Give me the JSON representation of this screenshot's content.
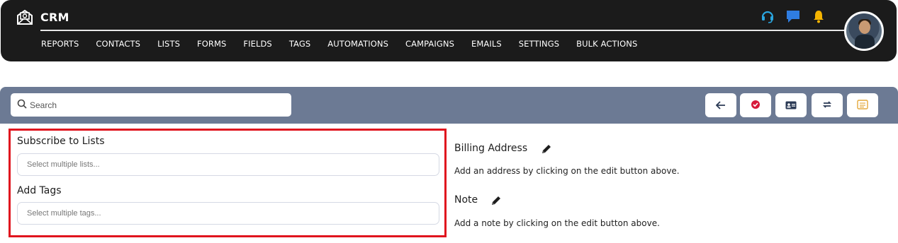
{
  "app": {
    "brand": "CRM"
  },
  "nav": [
    "REPORTS",
    "CONTACTS",
    "LISTS",
    "FORMS",
    "FIELDS",
    "TAGS",
    "AUTOMATIONS",
    "CAMPAIGNS",
    "EMAILS",
    "SETTINGS",
    "BULK ACTIONS"
  ],
  "search": {
    "placeholder": "Search"
  },
  "toolbar": {
    "buttons": [
      "back-arrow-icon",
      "check-circle-icon",
      "id-card-icon",
      "sync-icon",
      "notes-icon"
    ]
  },
  "form": {
    "subscribe_label": "Subscribe to Lists",
    "subscribe_placeholder": "Select multiple lists...",
    "tags_label": "Add Tags",
    "tags_placeholder": "Select multiple tags..."
  },
  "billing": {
    "title": "Billing Address",
    "text": "Add an address by clicking on the edit button above."
  },
  "note": {
    "title": "Note",
    "text": "Add a note by clicking on the edit button above."
  },
  "colors": {
    "header_bg": "#1b1b1b",
    "toolbar_bg": "#6c7a94",
    "highlight": "#e0141e",
    "accent_blue": "#2f7de1",
    "bell": "#f5b400"
  }
}
